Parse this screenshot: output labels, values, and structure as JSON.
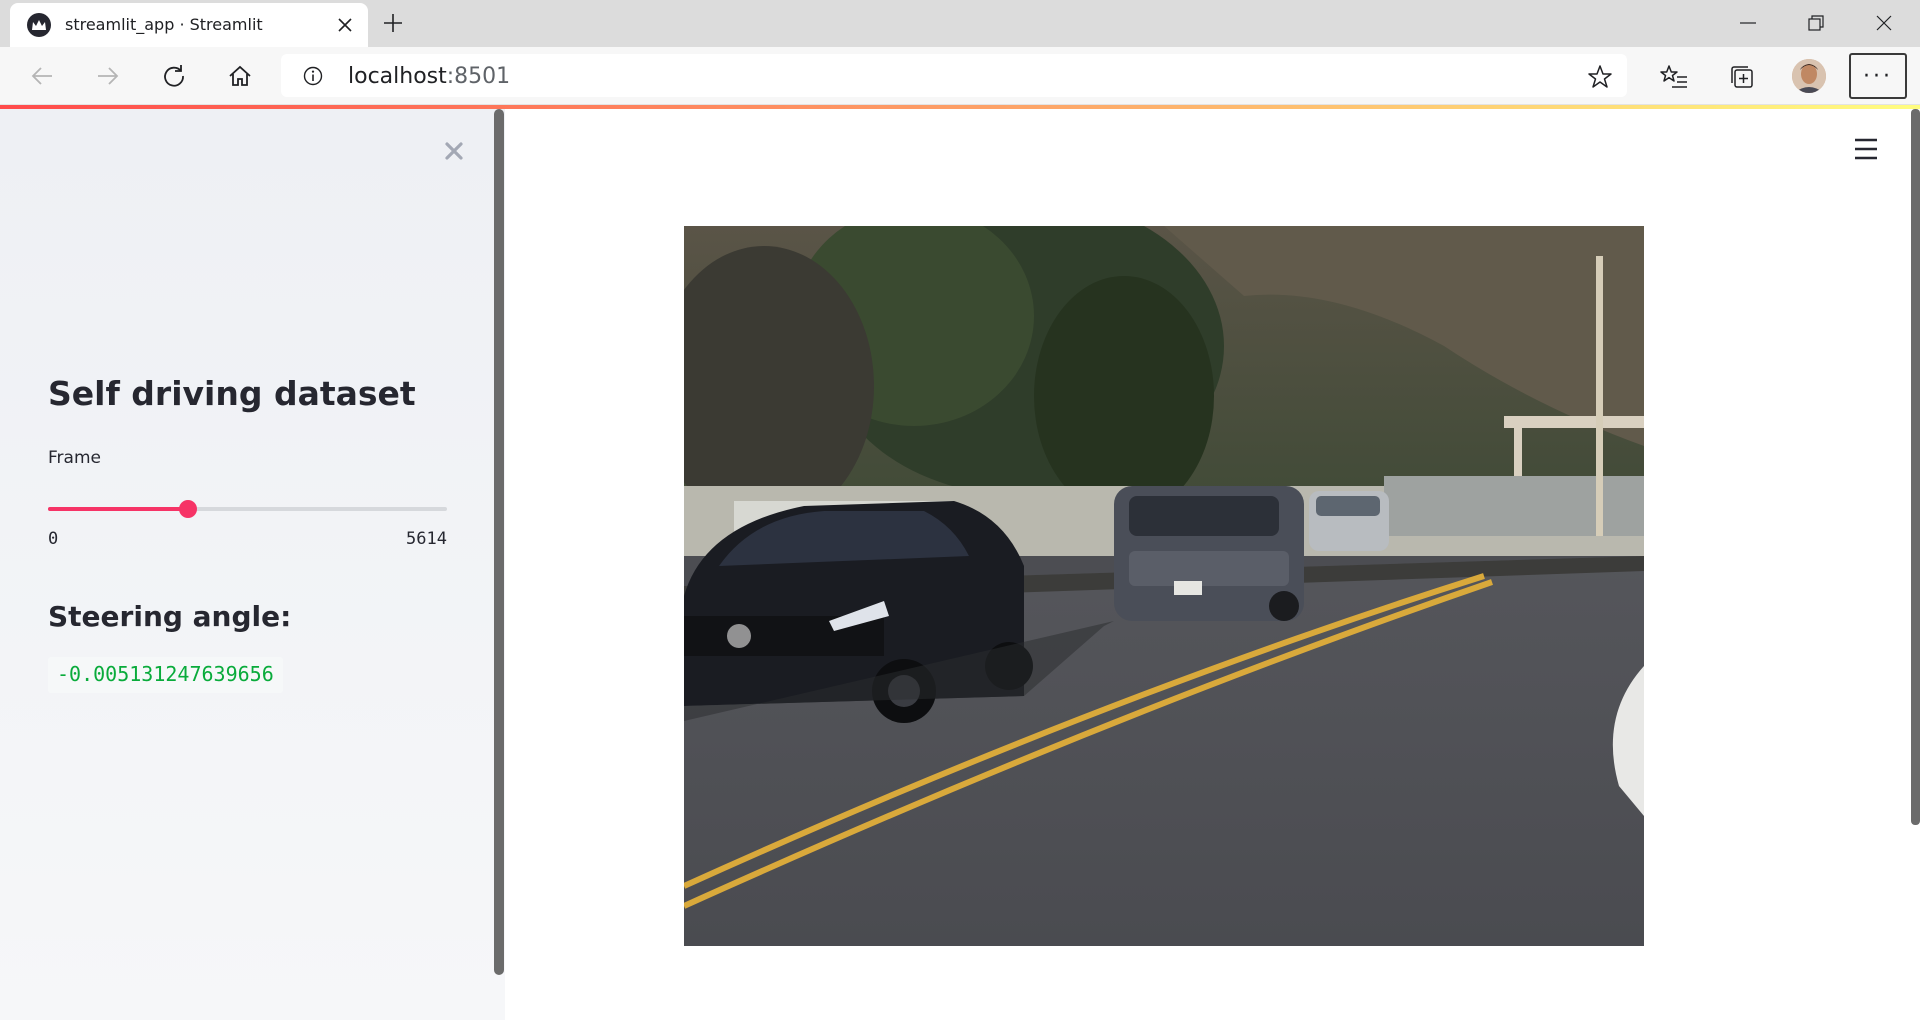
{
  "browser": {
    "tab_title": "streamlit_app · Streamlit",
    "url_host": "localhost",
    "url_port": ":8501",
    "new_tab_symbol": "+",
    "more_symbol": "···"
  },
  "sidebar": {
    "title": "Self driving dataset",
    "slider": {
      "label": "Frame",
      "min": 0,
      "max": 5614,
      "value_fraction": 0.35,
      "min_label": "0",
      "max_label": "5614"
    },
    "steering_heading": "Steering angle:",
    "steering_value": "-0.005131247639656"
  },
  "main": {
    "image_semantic": "dashcam-frame: road with double yellow line, black sedan, gray SUV and silver car, trees and hillside"
  },
  "colors": {
    "accent": "#f63366",
    "code_green": "#09ab3b",
    "sidebar_bg": "#f0f2f6",
    "text": "#262730"
  }
}
